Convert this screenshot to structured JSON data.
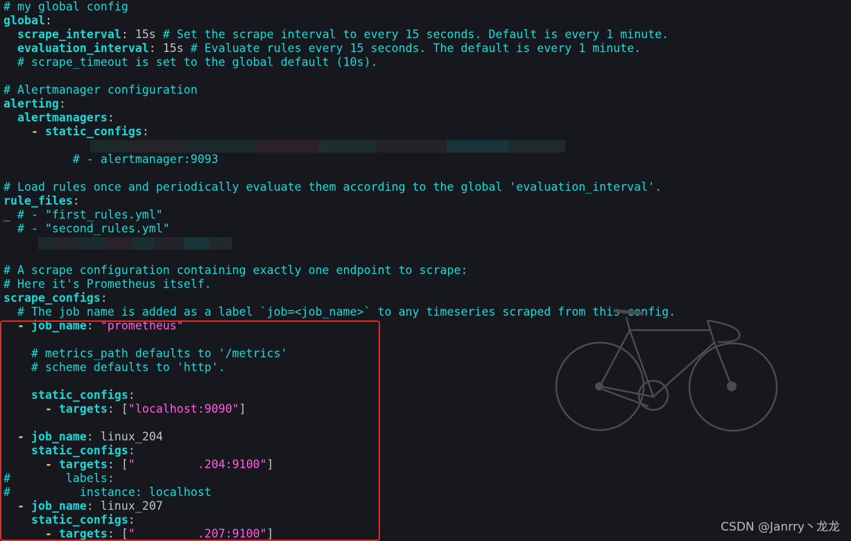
{
  "colors": {
    "background": "#16181d",
    "comment": "#1fd8d8",
    "key": "#1fd8d8",
    "value": "#c4c4c4",
    "string": "#ff5fdf",
    "dash": "#e0d050",
    "highlight_box": "#e52a2a"
  },
  "watermark": "CSDN @Janrry丶龙龙",
  "lines": [
    {
      "segs": [
        {
          "t": "c",
          "x": "# my global config"
        }
      ]
    },
    {
      "segs": [
        {
          "t": "k",
          "x": "global"
        },
        {
          "t": "p",
          "x": ":"
        }
      ]
    },
    {
      "segs": [
        {
          "t": "k",
          "x": "  scrape_interval"
        },
        {
          "t": "p",
          "x": ": "
        },
        {
          "t": "v",
          "x": "15s "
        },
        {
          "t": "c",
          "x": "# Set the scrape interval to every 15 seconds. Default is every 1 minute."
        }
      ]
    },
    {
      "segs": [
        {
          "t": "k",
          "x": "  evaluation_interval"
        },
        {
          "t": "p",
          "x": ": "
        },
        {
          "t": "v",
          "x": "15s "
        },
        {
          "t": "c",
          "x": "# Evaluate rules every 15 seconds. The default is every 1 minute."
        }
      ]
    },
    {
      "segs": [
        {
          "t": "c",
          "x": "  # scrape_timeout is set to the global default (10s)."
        }
      ]
    },
    {
      "segs": []
    },
    {
      "segs": [
        {
          "t": "c",
          "x": "# Alertmanager configuration"
        }
      ]
    },
    {
      "segs": [
        {
          "t": "k",
          "x": "alerting"
        },
        {
          "t": "p",
          "x": ":"
        }
      ]
    },
    {
      "segs": [
        {
          "t": "k",
          "x": "  alertmanagers"
        },
        {
          "t": "p",
          "x": ":"
        }
      ]
    },
    {
      "segs": [
        {
          "t": "d",
          "x": "    - "
        },
        {
          "t": "k",
          "x": "static_configs"
        },
        {
          "t": "p",
          "x": ":"
        }
      ]
    },
    {
      "blur": true,
      "segs": []
    },
    {
      "segs": [
        {
          "t": "c",
          "x": "          # - alertmanager:9093"
        }
      ]
    },
    {
      "segs": []
    },
    {
      "segs": [
        {
          "t": "c",
          "x": "# Load rules once and periodically evaluate them according to the global 'evaluation_interval'."
        }
      ]
    },
    {
      "segs": [
        {
          "t": "k",
          "x": "rule_files"
        },
        {
          "t": "p",
          "x": ":"
        }
      ]
    },
    {
      "segs": [
        {
          "t": "v",
          "x": "_ "
        },
        {
          "t": "c",
          "x": "# - \"first_rules.yml\""
        }
      ]
    },
    {
      "segs": [
        {
          "t": "c",
          "x": "  # - \"second_rules.yml\""
        }
      ]
    },
    {
      "blur": true,
      "segs": []
    },
    {
      "segs": []
    },
    {
      "segs": [
        {
          "t": "c",
          "x": "# A scrape configuration containing exactly one endpoint to scrape:"
        }
      ]
    },
    {
      "segs": [
        {
          "t": "c",
          "x": "# Here it's Prometheus itself."
        }
      ]
    },
    {
      "segs": [
        {
          "t": "k",
          "x": "scrape_configs"
        },
        {
          "t": "p",
          "x": ":"
        }
      ]
    },
    {
      "segs": [
        {
          "t": "c",
          "x": "  # The job name is added as a label `job=<job_name>` to any timeseries scraped from this config."
        }
      ]
    },
    {
      "segs": [
        {
          "t": "d",
          "x": "  - "
        },
        {
          "t": "k",
          "x": "job_name"
        },
        {
          "t": "p",
          "x": ": "
        },
        {
          "t": "s",
          "x": "\"prometheus\""
        }
      ]
    },
    {
      "segs": []
    },
    {
      "segs": [
        {
          "t": "c",
          "x": "    # metrics_path defaults to '/metrics'"
        }
      ]
    },
    {
      "segs": [
        {
          "t": "c",
          "x": "    # scheme defaults to 'http'."
        }
      ]
    },
    {
      "segs": []
    },
    {
      "segs": [
        {
          "t": "k",
          "x": "    static_configs"
        },
        {
          "t": "p",
          "x": ":"
        }
      ]
    },
    {
      "segs": [
        {
          "t": "d",
          "x": "      - "
        },
        {
          "t": "k",
          "x": "targets"
        },
        {
          "t": "p",
          "x": ": ["
        },
        {
          "t": "s",
          "x": "\"localhost:9090\""
        },
        {
          "t": "p",
          "x": "]"
        }
      ]
    },
    {
      "segs": []
    },
    {
      "segs": [
        {
          "t": "d",
          "x": "  - "
        },
        {
          "t": "k",
          "x": "job_name"
        },
        {
          "t": "p",
          "x": ": "
        },
        {
          "t": "v",
          "x": "linux_204"
        }
      ]
    },
    {
      "segs": [
        {
          "t": "k",
          "x": "    static_configs"
        },
        {
          "t": "p",
          "x": ":"
        }
      ]
    },
    {
      "segs": [
        {
          "t": "d",
          "x": "      - "
        },
        {
          "t": "k",
          "x": "targets"
        },
        {
          "t": "p",
          "x": ": ["
        },
        {
          "t": "s",
          "x": "\"         .204:9100\""
        },
        {
          "t": "p",
          "x": "]"
        }
      ]
    },
    {
      "segs": [
        {
          "t": "c",
          "x": "#        labels:"
        }
      ]
    },
    {
      "segs": [
        {
          "t": "c",
          "x": "#          instance: localhost"
        }
      ]
    },
    {
      "segs": [
        {
          "t": "d",
          "x": "  - "
        },
        {
          "t": "k",
          "x": "job_name"
        },
        {
          "t": "p",
          "x": ": "
        },
        {
          "t": "v",
          "x": "linux_207"
        }
      ]
    },
    {
      "segs": [
        {
          "t": "k",
          "x": "    static_configs"
        },
        {
          "t": "p",
          "x": ":"
        }
      ]
    },
    {
      "segs": [
        {
          "t": "d",
          "x": "      - "
        },
        {
          "t": "k",
          "x": "targets"
        },
        {
          "t": "p",
          "x": ": ["
        },
        {
          "t": "s",
          "x": "\"         .207:9100\""
        },
        {
          "t": "p",
          "x": "]"
        }
      ]
    }
  ]
}
